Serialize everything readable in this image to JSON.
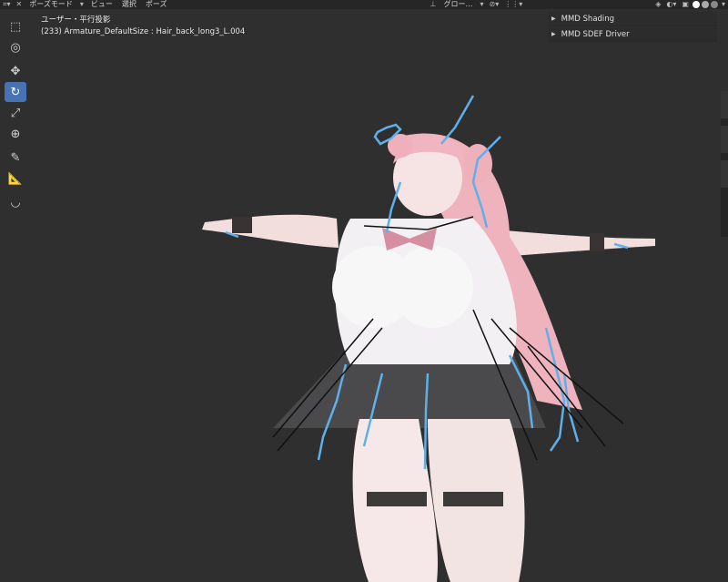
{
  "header": {
    "mode_label": "ポーズモード",
    "menu": [
      "ビュー",
      "選択",
      "ポーズ"
    ],
    "transform_orientation": "グロー…"
  },
  "viewport_info": {
    "view_name": "ユーザー・平行投影",
    "object_line": "(233) Armature_DefaultSize : Hair_back_long3_L.004"
  },
  "toolbar": {
    "tools": [
      "select-box-icon",
      "cursor-icon",
      "move-icon",
      "rotate-icon",
      "scale-icon",
      "transform-icon",
      "annotate-icon",
      "measure-icon",
      "bone-envelope-icon"
    ],
    "active_tool": "rotate-icon"
  },
  "npanel": {
    "sections": [
      "MMD Shading",
      "MMD SDEF Driver"
    ]
  },
  "colors": {
    "active_tool": "#4772b3",
    "bone_selected": "#5fb0e8",
    "bone_default": "#111111",
    "viewport_bg": "#2f2f2f"
  }
}
